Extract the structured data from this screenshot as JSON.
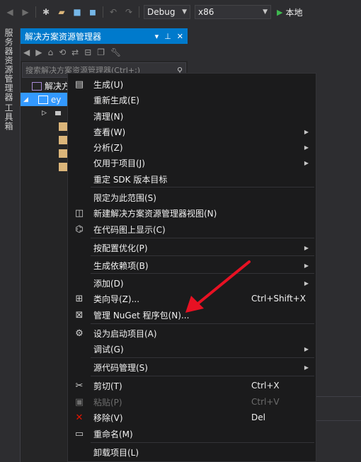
{
  "toolbar": {
    "config": "Debug",
    "platform": "x86",
    "run_label": "本地"
  },
  "side_tabs": [
    "服务器资源管理器",
    "工具箱"
  ],
  "solution_explorer": {
    "title": "解决方案资源管理器",
    "search_placeholder": "搜索解决方案资源管理器(Ctrl+;)",
    "tree": [
      {
        "label": "解决方"
      },
      {
        "label": "ey"
      }
    ]
  },
  "context_menu": {
    "items": [
      {
        "icon": "build-icon",
        "label": "生成(U)",
        "shortcut": "",
        "submenu": false,
        "disabled": false
      },
      {
        "icon": "",
        "label": "重新生成(E)",
        "shortcut": "",
        "submenu": false,
        "disabled": false
      },
      {
        "icon": "",
        "label": "清理(N)",
        "shortcut": "",
        "submenu": false,
        "disabled": false
      },
      {
        "icon": "",
        "label": "查看(W)",
        "shortcut": "",
        "submenu": true,
        "disabled": false
      },
      {
        "icon": "",
        "label": "分析(Z)",
        "shortcut": "",
        "submenu": true,
        "disabled": false
      },
      {
        "icon": "",
        "label": "仅用于项目(J)",
        "shortcut": "",
        "submenu": true,
        "disabled": false
      },
      {
        "icon": "",
        "label": "重定 SDK 版本目标",
        "shortcut": "",
        "submenu": false,
        "disabled": false
      },
      {
        "icon": "",
        "label": "限定为此范围(S)",
        "shortcut": "",
        "submenu": false,
        "disabled": false
      },
      {
        "icon": "new-view-icon",
        "label": "新建解决方案资源管理器视图(N)",
        "shortcut": "",
        "submenu": false,
        "disabled": false
      },
      {
        "icon": "code-map-icon",
        "label": "在代码图上显示(C)",
        "shortcut": "",
        "submenu": false,
        "disabled": false
      },
      {
        "icon": "",
        "label": "按配置优化(P)",
        "shortcut": "",
        "submenu": true,
        "disabled": false
      },
      {
        "icon": "",
        "label": "生成依赖项(B)",
        "shortcut": "",
        "submenu": true,
        "disabled": false
      },
      {
        "icon": "",
        "label": "添加(D)",
        "shortcut": "",
        "submenu": true,
        "disabled": false
      },
      {
        "icon": "class-wizard-icon",
        "label": "类向导(Z)...",
        "shortcut": "Ctrl+Shift+X",
        "submenu": false,
        "disabled": false
      },
      {
        "icon": "nuget-icon",
        "label": "管理 NuGet 程序包(N)...",
        "shortcut": "",
        "submenu": false,
        "disabled": false
      },
      {
        "icon": "gear-icon",
        "label": "设为启动项目(A)",
        "shortcut": "",
        "submenu": false,
        "disabled": false
      },
      {
        "icon": "",
        "label": "调试(G)",
        "shortcut": "",
        "submenu": true,
        "disabled": false
      },
      {
        "icon": "",
        "label": "源代码管理(S)",
        "shortcut": "",
        "submenu": true,
        "disabled": false
      },
      {
        "icon": "scissors-icon",
        "label": "剪切(T)",
        "shortcut": "Ctrl+X",
        "submenu": false,
        "disabled": false
      },
      {
        "icon": "paste-icon",
        "label": "粘贴(P)",
        "shortcut": "Ctrl+V",
        "submenu": false,
        "disabled": true
      },
      {
        "icon": "remove-icon",
        "label": "移除(V)",
        "shortcut": "Del",
        "submenu": false,
        "disabled": false
      },
      {
        "icon": "rename-icon",
        "label": "重命名(M)",
        "shortcut": "",
        "submenu": false,
        "disabled": false
      },
      {
        "icon": "",
        "label": "卸载项目(L)",
        "shortcut": "",
        "submenu": false,
        "disabled": false
      }
    ],
    "colors": {
      "remove": "#e51400",
      "annotation_arrow": "#e81123"
    }
  }
}
